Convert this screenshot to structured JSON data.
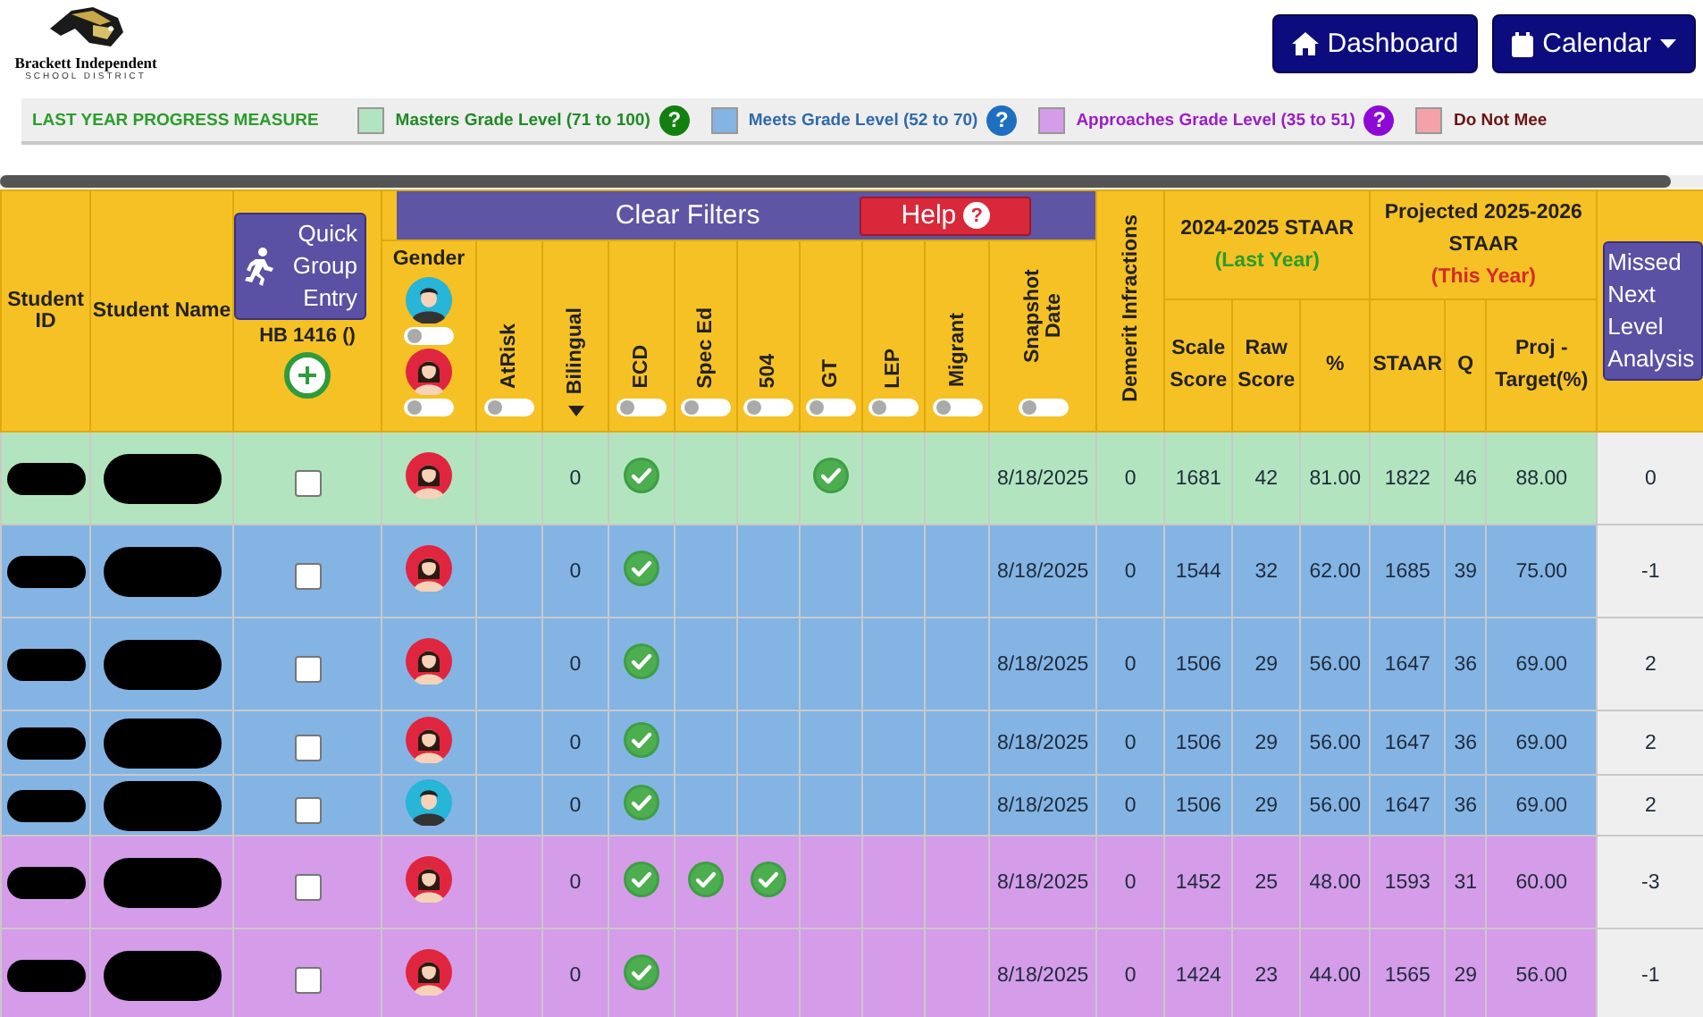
{
  "logo": {
    "name": "Brackett Independent",
    "subtitle": "SCHOOL DISTRICT"
  },
  "nav_buttons": [
    {
      "label": "Dashboard",
      "kind": "home",
      "dropdown": false
    },
    {
      "label": "Calendar",
      "kind": "calendar",
      "dropdown": true
    }
  ],
  "legend": {
    "title": "LAST YEAR PROGRESS MEASURE",
    "items": [
      {
        "label": "Masters Grade Level (71 to 100)",
        "color": "#b2e5bf",
        "help": "?"
      },
      {
        "label": "Meets Grade Level (52 to 70)",
        "color": "#84b4e4",
        "help": "?"
      },
      {
        "label": "Approaches Grade Level (35 to 51)",
        "color": "#d59ce9",
        "help": "?"
      },
      {
        "label": "Do Not Mee",
        "color": "#f2a2a8"
      }
    ]
  },
  "table": {
    "id_header": "Student ID",
    "name_header": "Student Name",
    "quick_entry": {
      "label": "Quick Group Entry",
      "hb_label": "HB 1416 ()"
    },
    "clear_filters": "Clear Filters",
    "help": "Help",
    "help_icon": "?",
    "filters": [
      {
        "label": "Gender",
        "kind": "gender",
        "toggles": [
          {
            "kind": "male",
            "on": false
          },
          {
            "kind": "female",
            "on": false
          }
        ]
      },
      {
        "label": "AtRisk",
        "kind": "toggle",
        "on": false
      },
      {
        "label": "Bilingual",
        "kind": "sort"
      },
      {
        "label": "ECD",
        "kind": "toggle",
        "on": false
      },
      {
        "label": "Spec Ed",
        "kind": "toggle",
        "on": false
      },
      {
        "label": "504",
        "kind": "toggle",
        "on": false
      },
      {
        "label": "GT",
        "kind": "toggle",
        "on": false
      },
      {
        "label": "LEP",
        "kind": "toggle",
        "on": false
      },
      {
        "label": "Migrant",
        "kind": "toggle",
        "on": false
      },
      {
        "label": "Snapshot Date",
        "kind": "toggle",
        "on": false
      }
    ],
    "demerit_header": "Demerit Infractions",
    "groups": [
      {
        "title": "2024-2025 STAAR",
        "note": "(Last Year)",
        "columns": [
          "Scale Score",
          "Raw Score",
          "%"
        ]
      },
      {
        "title": "Projected 2025-2026 STAAR",
        "note": "(This Year)",
        "columns": [
          "STAAR",
          "Q",
          "Proj - Target(%)"
        ]
      }
    ],
    "missed_button": "Missed Next Level Analysis",
    "rows": [
      {
        "color": "#b2e5bf",
        "redacted": true,
        "checked": false,
        "kind": "female",
        "atrisk": false,
        "bilingual": "0",
        "ecd": true,
        "spec_ed": false,
        "s504": false,
        "gt": true,
        "lep": false,
        "migrant": false,
        "snapshot_date": "8/18/2025",
        "demerits": "0",
        "scale_score": "1681",
        "raw_score": "42",
        "percent": "81.00",
        "staar": "1822",
        "q": "46",
        "proj_target": "88.00",
        "missed": "0"
      },
      {
        "color": "#84b4e4",
        "redacted": true,
        "checked": false,
        "kind": "female",
        "atrisk": false,
        "bilingual": "0",
        "ecd": true,
        "spec_ed": false,
        "s504": false,
        "gt": false,
        "lep": false,
        "migrant": false,
        "snapshot_date": "8/18/2025",
        "demerits": "0",
        "scale_score": "1544",
        "raw_score": "32",
        "percent": "62.00",
        "staar": "1685",
        "q": "39",
        "proj_target": "75.00",
        "missed": "-1"
      },
      {
        "color": "#84b4e4",
        "redacted": true,
        "checked": false,
        "kind": "female",
        "atrisk": false,
        "bilingual": "0",
        "ecd": true,
        "spec_ed": false,
        "s504": false,
        "gt": false,
        "lep": false,
        "migrant": false,
        "snapshot_date": "8/18/2025",
        "demerits": "0",
        "scale_score": "1506",
        "raw_score": "29",
        "percent": "56.00",
        "staar": "1647",
        "q": "36",
        "proj_target": "69.00",
        "missed": "2"
      },
      {
        "color": "#84b4e4",
        "redacted": true,
        "checked": false,
        "kind": "female",
        "atrisk": false,
        "bilingual": "0",
        "ecd": true,
        "spec_ed": false,
        "s504": false,
        "gt": false,
        "lep": false,
        "migrant": false,
        "snapshot_date": "8/18/2025",
        "demerits": "0",
        "scale_score": "1506",
        "raw_score": "29",
        "percent": "56.00",
        "staar": "1647",
        "q": "36",
        "proj_target": "69.00",
        "missed": "2"
      },
      {
        "color": "#84b4e4",
        "redacted": true,
        "checked": false,
        "kind": "male",
        "atrisk": false,
        "bilingual": "0",
        "ecd": true,
        "spec_ed": false,
        "s504": false,
        "gt": false,
        "lep": false,
        "migrant": false,
        "snapshot_date": "8/18/2025",
        "demerits": "0",
        "scale_score": "1506",
        "raw_score": "29",
        "percent": "56.00",
        "staar": "1647",
        "q": "36",
        "proj_target": "69.00",
        "missed": "2"
      },
      {
        "color": "#d59ce9",
        "redacted": true,
        "checked": false,
        "kind": "female",
        "atrisk": false,
        "bilingual": "0",
        "ecd": true,
        "spec_ed": true,
        "s504": true,
        "gt": false,
        "lep": false,
        "migrant": false,
        "snapshot_date": "8/18/2025",
        "demerits": "0",
        "scale_score": "1452",
        "raw_score": "25",
        "percent": "48.00",
        "staar": "1593",
        "q": "31",
        "proj_target": "60.00",
        "missed": "-3"
      },
      {
        "color": "#d59ce9",
        "redacted": true,
        "checked": false,
        "kind": "female",
        "atrisk": false,
        "bilingual": "0",
        "ecd": true,
        "spec_ed": false,
        "s504": false,
        "gt": false,
        "lep": false,
        "migrant": false,
        "snapshot_date": "8/18/2025",
        "demerits": "0",
        "scale_score": "1424",
        "raw_score": "23",
        "percent": "44.00",
        "staar": "1565",
        "q": "29",
        "proj_target": "56.00",
        "missed": "-1"
      }
    ]
  }
}
